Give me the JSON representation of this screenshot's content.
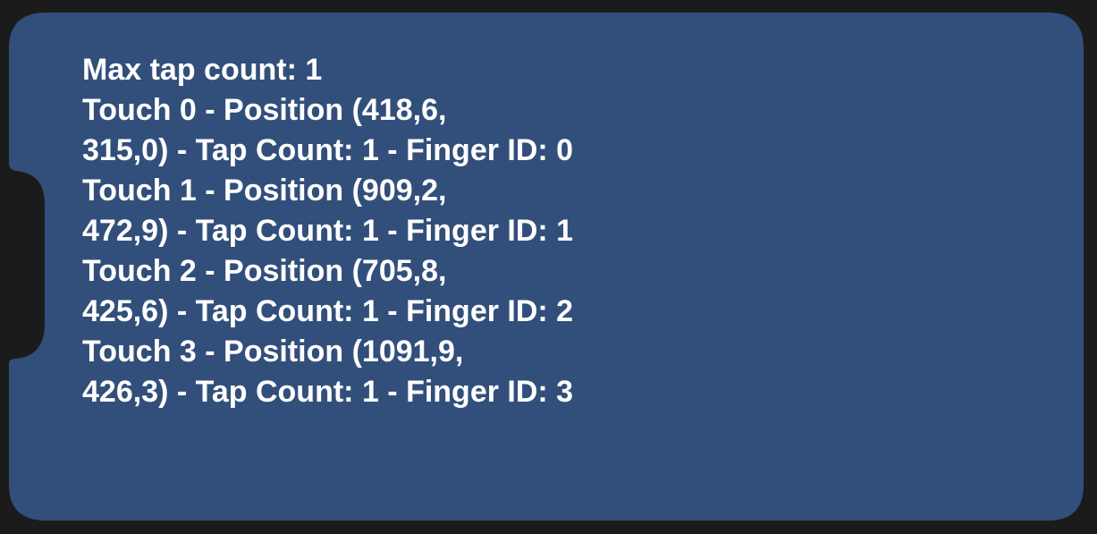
{
  "colors": {
    "page_background": "#1b1b1b",
    "panel_fill": "#324f7b",
    "text": "#ffffff"
  },
  "readout": {
    "lines": [
      "Max tap count: 1",
      "Touch 0 - Position (418,6,",
      "315,0) - Tap Count: 1 - Finger ID: 0",
      "Touch 1 - Position (909,2,",
      "472,9) - Tap Count: 1 - Finger ID: 1",
      "Touch 2 - Position (705,8,",
      "425,6) - Tap Count: 1 - Finger ID: 2",
      "Touch 3 - Position (1091,9,",
      "426,3) - Tap Count: 1 - Finger ID: 3"
    ]
  }
}
